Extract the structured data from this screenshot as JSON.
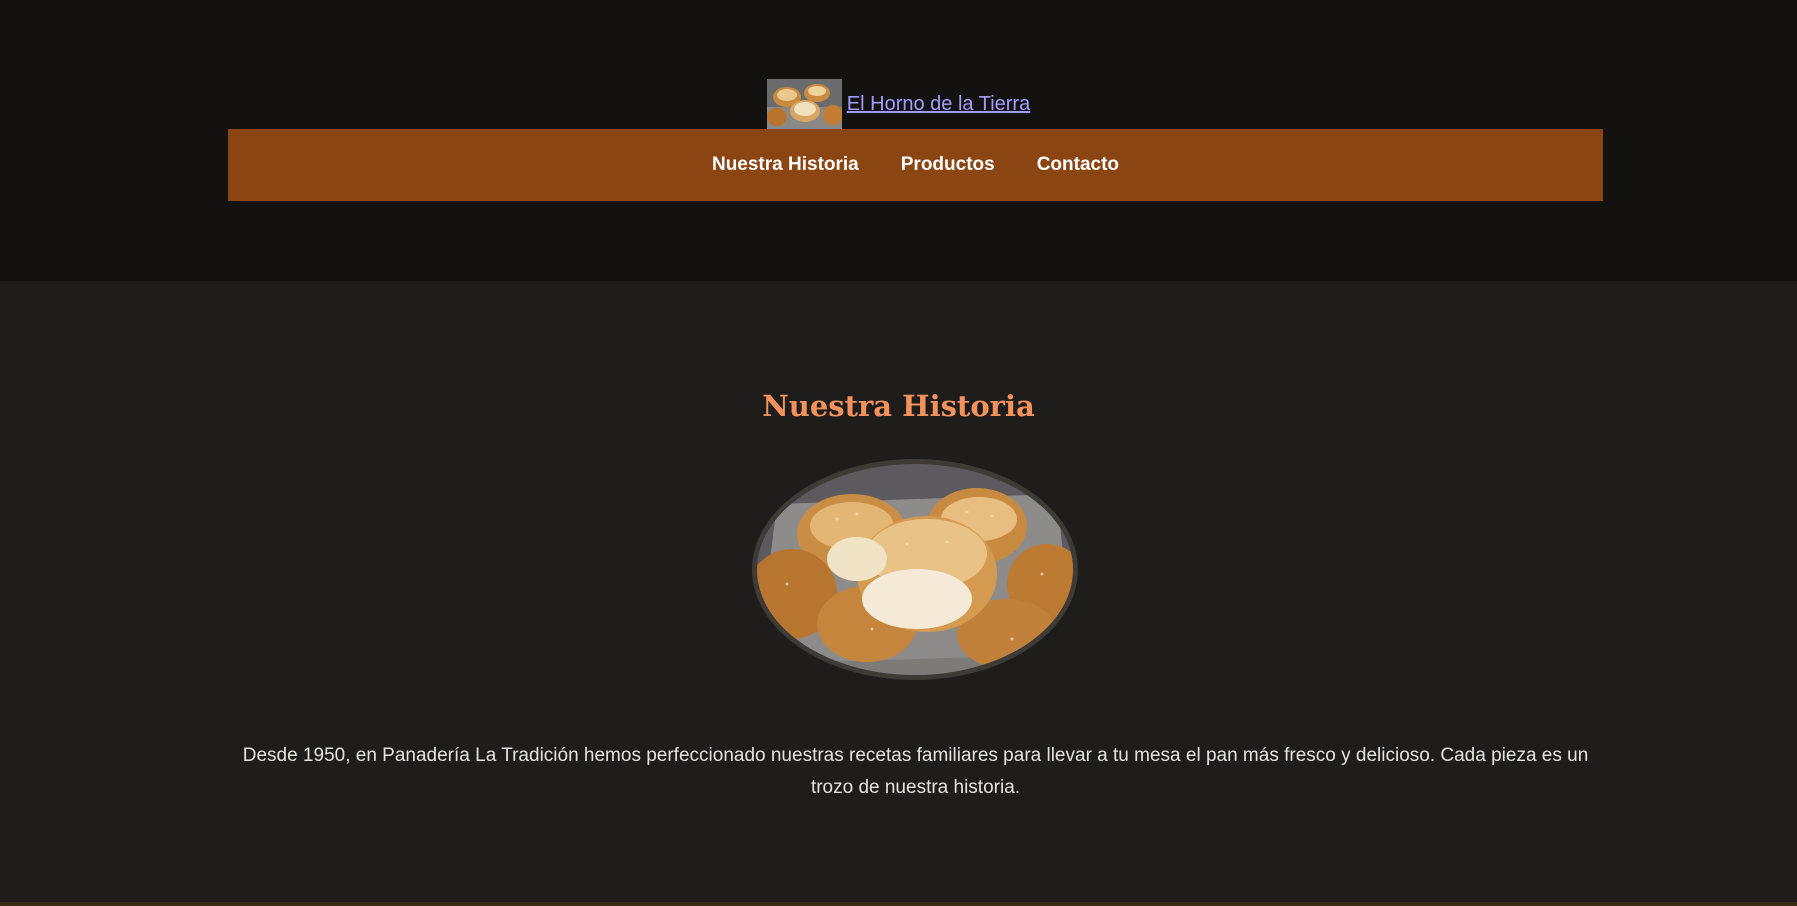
{
  "header": {
    "brand_name": "El Horno de la Tierra",
    "logo_icon": "bread-rolls-logo"
  },
  "nav": {
    "items": [
      {
        "label": "Nuestra Historia"
      },
      {
        "label": "Productos"
      },
      {
        "label": "Contacto"
      }
    ]
  },
  "story": {
    "title": "Nuestra Historia",
    "image_icon": "bread-rolls-photo",
    "text": "Desde 1950, en Panadería La Tradición hemos perfeccionado nuestras recetas familiares para llevar a tu mesa el pan más fresco y delicioso. Cada pieza es un trozo de nuestra historia."
  },
  "colors": {
    "header_bg": "#131211",
    "section_bg": "#1e1d1c",
    "nav_bg": "#8b4513",
    "title_accent": "#f4925c",
    "link": "#a39cff"
  }
}
